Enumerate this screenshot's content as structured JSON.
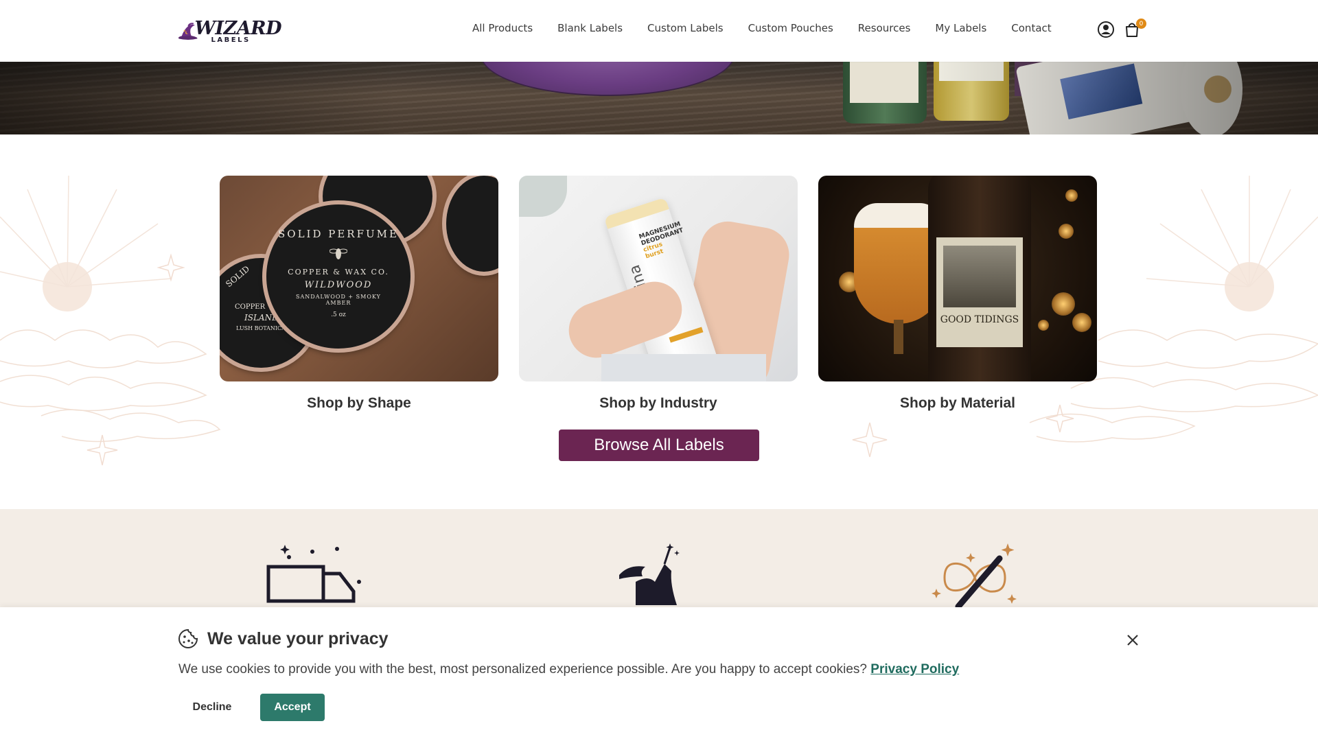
{
  "header": {
    "logo": {
      "word": "WIZARD",
      "sub": "LABELS"
    },
    "nav": [
      "All Products",
      "Blank Labels",
      "Custom Labels",
      "Custom Pouches",
      "Resources",
      "My Labels",
      "Contact"
    ],
    "cart_count": "0",
    "icons": [
      "account-icon",
      "cart-icon"
    ]
  },
  "hero": {
    "icons": []
  },
  "shop": {
    "cards": [
      {
        "title": "Shop by Shape"
      },
      {
        "title": "Shop by Industry"
      },
      {
        "title": "Shop by Material"
      }
    ],
    "browse_label": "Browse All Labels"
  },
  "card_art": {
    "tin_main": {
      "line1": "SOLID PERFUME",
      "line2": "COPPER & WAX CO.",
      "line3": "WILDWOOD",
      "line4": "SANDALWOOD + SMOKY AMBER",
      "line5": ".5 oz"
    },
    "tin_side": {
      "line1": "SOLID",
      "line2": "COPPER",
      "line3": "ISLAND",
      "line4": "LUSH BOTANICAL CITRUS"
    },
    "deodorant": {
      "brand": "verefina",
      "line1": "MAGNESIUM",
      "line2": "DEODORANT",
      "line3": "citrus",
      "line4": "burst"
    },
    "beer": {
      "label": "GOOD TIDINGS"
    }
  },
  "features": {
    "icons": [
      "truck-icon",
      "wizard-icon",
      "infinity-wand-icon"
    ]
  },
  "cookie": {
    "title": "We value your privacy",
    "body": "We use cookies to provide you with the best, most personalized experience possible. Are you happy to accept cookies?",
    "link": "Privacy Policy",
    "decline": "Decline",
    "accept": "Accept"
  },
  "colors": {
    "brand_purple": "#6b2552",
    "accept_green": "#2d7a6b",
    "link_green": "#1f6b5e",
    "features_bg": "#f3ede6",
    "badge_orange": "#e08a16"
  }
}
